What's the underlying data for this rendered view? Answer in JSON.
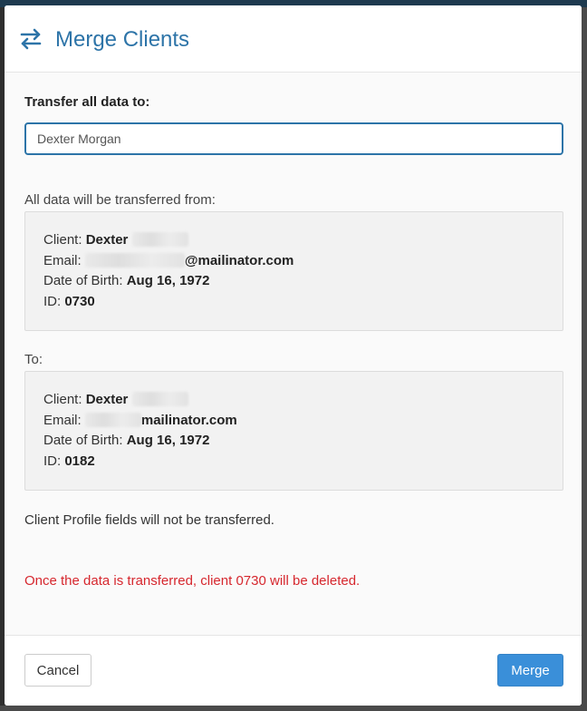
{
  "modal": {
    "title": "Merge Clients",
    "title_icon": "swap-arrows-icon",
    "accent_color": "#2d74a8"
  },
  "form": {
    "transfer_label": "Transfer all data to:",
    "target_value": "Dexter Morgan"
  },
  "source": {
    "heading": "All data will be transferred from:",
    "client_label": "Client:",
    "client_name": "Dexter",
    "email_label": "Email:",
    "email_visible": "@mailinator.com",
    "dob_label": "Date of Birth:",
    "dob": "Aug 16, 1972",
    "id_label": "ID:",
    "id": "0730"
  },
  "destination": {
    "heading": "To:",
    "client_label": "Client:",
    "client_name": "Dexter",
    "email_label": "Email:",
    "email_visible": "mailinator.com",
    "dob_label": "Date of Birth:",
    "dob": "Aug 16, 1972",
    "id_label": "ID:",
    "id": "0182"
  },
  "notes": {
    "profile_fields": "Client Profile fields will not be transferred.",
    "warning": "Once the data is transferred, client 0730 will be deleted.",
    "warning_color": "#d6272e"
  },
  "footer": {
    "cancel_label": "Cancel",
    "merge_label": "Merge",
    "merge_color": "#3a8fd9"
  }
}
